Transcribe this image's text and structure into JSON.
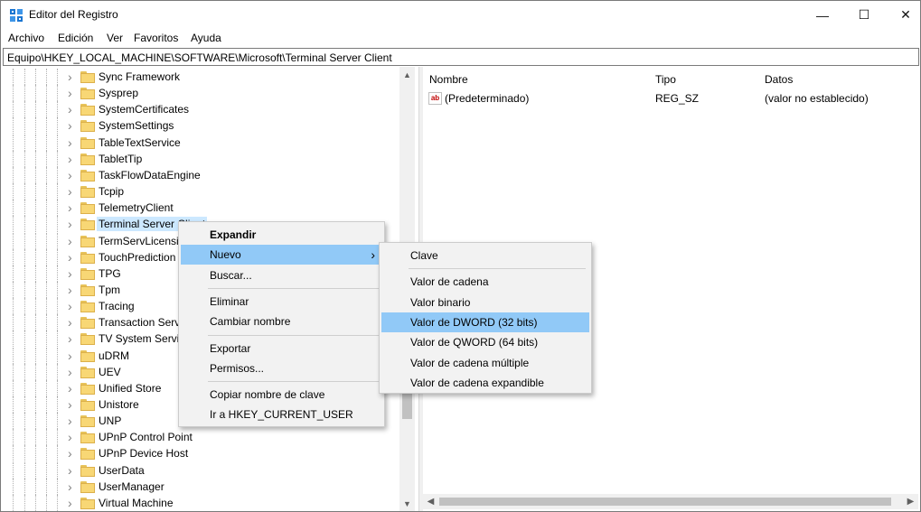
{
  "window": {
    "title": "Editor del Registro",
    "minimize": "—",
    "maximize": "☐",
    "close": "✕"
  },
  "menubar": [
    "Archivo",
    "Edición",
    "Ver",
    "Favoritos",
    "Ayuda"
  ],
  "address": "Equipo\\HKEY_LOCAL_MACHINE\\SOFTWARE\\Microsoft\\Terminal Server Client",
  "tree": {
    "items": [
      {
        "label": "Sync Framework"
      },
      {
        "label": "Sysprep"
      },
      {
        "label": "SystemCertificates"
      },
      {
        "label": "SystemSettings"
      },
      {
        "label": "TableTextService"
      },
      {
        "label": "TabletTip"
      },
      {
        "label": "TaskFlowDataEngine"
      },
      {
        "label": "Tcpip"
      },
      {
        "label": "TelemetryClient"
      },
      {
        "label": "Terminal Server Client",
        "selected": true
      },
      {
        "label": "TermServLicensing"
      },
      {
        "label": "TouchPrediction"
      },
      {
        "label": "TPG"
      },
      {
        "label": "Tpm"
      },
      {
        "label": "Tracing"
      },
      {
        "label": "Transaction Server"
      },
      {
        "label": "TV System Services"
      },
      {
        "label": "uDRM"
      },
      {
        "label": "UEV"
      },
      {
        "label": "Unified Store"
      },
      {
        "label": "Unistore"
      },
      {
        "label": "UNP"
      },
      {
        "label": "UPnP Control Point"
      },
      {
        "label": "UPnP Device Host"
      },
      {
        "label": "UserData"
      },
      {
        "label": "UserManager"
      },
      {
        "label": "Virtual Machine"
      }
    ]
  },
  "values": {
    "headers": {
      "name": "Nombre",
      "type": "Tipo",
      "data": "Datos"
    },
    "rows": [
      {
        "icon": "ab",
        "name": "(Predeterminado)",
        "type": "REG_SZ",
        "data": "(valor no establecido)"
      }
    ]
  },
  "context_menu": {
    "items": [
      {
        "label": "Expandir",
        "bold": true
      },
      {
        "label": "Nuevo",
        "submenu": true,
        "hover": true
      },
      {
        "label": "Buscar..."
      },
      {
        "sep": true
      },
      {
        "label": "Eliminar"
      },
      {
        "label": "Cambiar nombre"
      },
      {
        "sep": true
      },
      {
        "label": "Exportar"
      },
      {
        "label": "Permisos..."
      },
      {
        "sep": true
      },
      {
        "label": "Copiar nombre de clave"
      },
      {
        "label": "Ir a HKEY_CURRENT_USER"
      }
    ]
  },
  "submenu": {
    "items": [
      {
        "label": "Clave"
      },
      {
        "sep": true
      },
      {
        "label": "Valor de cadena"
      },
      {
        "label": "Valor binario"
      },
      {
        "label": "Valor de DWORD (32 bits)",
        "hover": true
      },
      {
        "label": "Valor de QWORD (64 bits)"
      },
      {
        "label": "Valor de cadena múltiple"
      },
      {
        "label": "Valor de cadena expandible"
      }
    ]
  }
}
